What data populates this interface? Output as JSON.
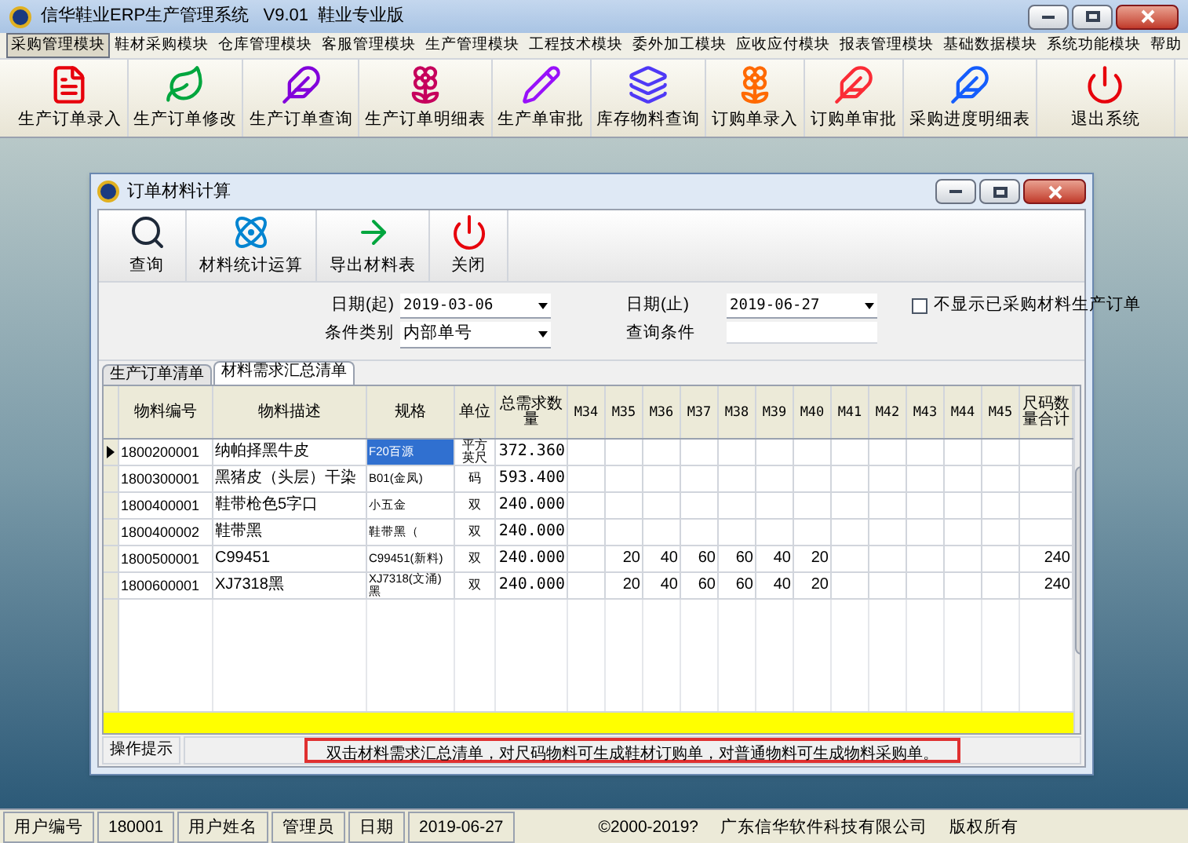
{
  "window": {
    "title": "信华鞋业ERP生产管理系统   V9.01  鞋业专业版"
  },
  "menu": [
    {
      "label": "采购管理模块",
      "selected": true
    },
    {
      "label": "鞋材采购模块",
      "selected": false
    },
    {
      "label": "仓库管理模块",
      "selected": false
    },
    {
      "label": "客服管理模块",
      "selected": false
    },
    {
      "label": "生产管理模块",
      "selected": false
    },
    {
      "label": "工程技术模块",
      "selected": false
    },
    {
      "label": "委外加工模块",
      "selected": false
    },
    {
      "label": "应收应付模块",
      "selected": false
    },
    {
      "label": "报表管理模块",
      "selected": false
    },
    {
      "label": "基础数据模块",
      "selected": false
    },
    {
      "label": "系统功能模块",
      "selected": false
    },
    {
      "label": "帮助",
      "selected": false
    }
  ],
  "toolbar": [
    "生产订单录入",
    "生产订单修改",
    "生产订单查询",
    "生产订单明细表",
    "生产单审批",
    "库存物料查询",
    "订购单录入",
    "订购单审批",
    "采购进度明细表",
    "退出系统"
  ],
  "dialog": {
    "title": "订单材料计算",
    "toolbar": [
      "查询",
      "材料统计运算",
      "导出材料表",
      "关闭"
    ],
    "filters": {
      "date_from_label": "日期(起)",
      "date_from": "2019-03-06",
      "date_to_label": "日期(止)",
      "date_to": "2019-06-27",
      "hide_purchased": {
        "label": "不显示已采购材料生产订单",
        "checked": false
      },
      "condition_type_label": "条件类别",
      "condition_type": "内部单号",
      "query_label": "查询条件"
    },
    "tabs": [
      {
        "label": "生产订单清单",
        "selected": false
      },
      {
        "label": "材料需求汇总清单",
        "selected": true
      }
    ],
    "table": {
      "columns": [
        "物料编号",
        "物料描述",
        "规格",
        "单位",
        "总需求数量",
        "M34",
        "M35",
        "M36",
        "M37",
        "M38",
        "M39",
        "M40",
        "M41",
        "M42",
        "M43",
        "M44",
        "M45",
        "尺码数量合计"
      ],
      "rows": [
        {
          "selected": true,
          "cells": [
            "1800200001",
            "纳帕择黑牛皮",
            "F20百源",
            "平方英尺",
            "372.360",
            "",
            "",
            "",
            "",
            "",
            "",
            "",
            "",
            "",
            "",
            "",
            "",
            ""
          ]
        },
        {
          "selected": false,
          "cells": [
            "1800300001",
            "黑猪皮（头层）干染",
            "B01(金凤)",
            "码",
            "593.400",
            "",
            "",
            "",
            "",
            "",
            "",
            "",
            "",
            "",
            "",
            "",
            "",
            ""
          ]
        },
        {
          "selected": false,
          "cells": [
            "1800400001",
            "鞋带枪色5字口",
            "小五金",
            "双",
            "240.000",
            "",
            "",
            "",
            "",
            "",
            "",
            "",
            "",
            "",
            "",
            "",
            "",
            ""
          ]
        },
        {
          "selected": false,
          "cells": [
            "1800400002",
            "鞋带黑",
            "鞋带黑（",
            "双",
            "240.000",
            "",
            "",
            "",
            "",
            "",
            "",
            "",
            "",
            "",
            "",
            "",
            "",
            ""
          ]
        },
        {
          "selected": false,
          "cells": [
            "1800500001",
            "C99451",
            "C99451(新料)",
            "双",
            "240.000",
            "",
            "20",
            "40",
            "60",
            "60",
            "40",
            "20",
            "",
            "",
            "",
            "",
            "",
            "240"
          ]
        },
        {
          "selected": false,
          "cells": [
            "1800600001",
            "XJ7318黑",
            "XJ7318(文涌)黑",
            "双",
            "240.000",
            "",
            "20",
            "40",
            "60",
            "60",
            "40",
            "20",
            "",
            "",
            "",
            "",
            "",
            "240"
          ]
        }
      ]
    },
    "hint": {
      "label": "操作提示",
      "text": "双击材料需求汇总清单，对尺码物料可生成鞋材订购单，对普通物料可生成物料采购单。"
    }
  },
  "status_bar": [
    "用户编号",
    "180001",
    "用户姓名",
    "管理员",
    "日期",
    "2019-06-27",
    "©2000-2019?",
    "广东信华软件科技有限公司",
    "版权所有"
  ]
}
